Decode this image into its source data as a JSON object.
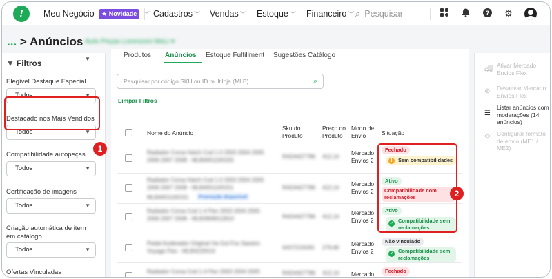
{
  "topbar": {
    "brand": "Meu Negócio",
    "novidade_badge": "Novidade",
    "nav_items": [
      "Cadastros",
      "Vendas",
      "Estoque",
      "Financeiro"
    ],
    "search_placeholder": "Pesquisar",
    "icons": [
      "grid-icon",
      "bell-icon",
      "help-icon",
      "gear-icon",
      "user-avatar-icon"
    ]
  },
  "header": {
    "breadcrumb_dots": "...",
    "breadcrumb_sep": ">",
    "title": "Anúncios",
    "account_name": "Auto Peças Lorenzoni MeLi"
  },
  "sidebar": {
    "title": "Filtros",
    "filters": [
      {
        "label": "Elegível Destaque Especial",
        "value": "Todos"
      },
      {
        "label": "Destacado nos Mais Vendidos",
        "value": "Todos"
      },
      {
        "label": "Compatibilidade autopeças",
        "value": "Todos"
      },
      {
        "label": "Certificação de imagens",
        "value": "Todos"
      },
      {
        "label": "Criação automática de item em catálogo",
        "value": "Todos"
      },
      {
        "label": "Ofertas Vinculadas",
        "value": ""
      }
    ]
  },
  "main": {
    "tabs": [
      "Produtos",
      "Anúncios",
      "Estoque Fulfillment",
      "Sugestões Catálogo"
    ],
    "active_tab": "Anúncios",
    "search_placeholder": "Pesquisar por código SKU ou ID multiloja (MLB)",
    "clear_filters": "Limpar Filtros",
    "columns": {
      "name": "Nome do Anúncio",
      "sku": "Sku do Produto",
      "price": "Preço do Produto",
      "shipping": "Modo de Envio",
      "status": "Situação"
    },
    "rows": [
      {
        "name_l1": "Radiador Corsa Hatch Cod 1.0 2003 2004 2005",
        "name_l2": "2006 2007 2008 - MLB4051100150",
        "sku": "RAD4427786",
        "price": "412,14",
        "shipping": "Mercado Envios 2",
        "status": "Fechado",
        "detail": "Sem compatibilidades"
      },
      {
        "name_l1": "Radiador Corsa Hatch Cod 1.0 2003 2004 2005",
        "name_l2": "2006 2007 2008 - MLB4051100151",
        "name_l3": "MLB4051100151",
        "promo": "Promoção disponível",
        "sku": "RAD4427786",
        "price": "412,14",
        "shipping": "Mercado Envios 2",
        "status": "Ativo",
        "detail": "Compatibilidade com reclamações"
      },
      {
        "name_l1": "Radiador Corsa Cod 1.4 Flex 2003 2004 2005",
        "name_l2": "2006 2007 2008 - MLB3908012810",
        "sku": "RAD4427786",
        "price": "412,14",
        "shipping": "Mercado Envios 2",
        "status": "Ativo",
        "detail": "Compatibilidade sem reclamações"
      },
      {
        "name_l1": "Pedal Acelerador Original Vw Gol Fox Saveiro",
        "name_l2": "Voyage Flex - MLB4220014",
        "sku": "6X0721503G",
        "price": "279,90",
        "shipping": "Mercado Envios 2",
        "status": "Não vinculado",
        "detail": "Compatibilidade sem reclamações"
      },
      {
        "name_l1": "Radiador Corsa Cod 1.4 Flex 2003 2004 2005",
        "name_l2": "",
        "sku": "RAD4427786",
        "price": "412,14",
        "shipping": "Mercado",
        "status": "Fechado",
        "detail": ""
      }
    ]
  },
  "right_panel": {
    "items": [
      {
        "label": "Ativar Mercado Envios Flex",
        "enabled": false,
        "icon": "truck-icon"
      },
      {
        "label": "Desativar Mercado Envios Flex",
        "enabled": false,
        "icon": "truck-off-icon"
      },
      {
        "label": "Listar anúncios com moderações (14 anúncios)",
        "enabled": true,
        "icon": "list-icon"
      },
      {
        "label": "Configurar formato de envio (ME1 / ME2)",
        "enabled": false,
        "icon": "truck-config-icon"
      }
    ]
  },
  "annotations": [
    "1",
    "2"
  ],
  "colors": {
    "brand_green": "#1faa59",
    "annotation_red": "#e02020",
    "novidade_purple": "#7a4ce0"
  }
}
